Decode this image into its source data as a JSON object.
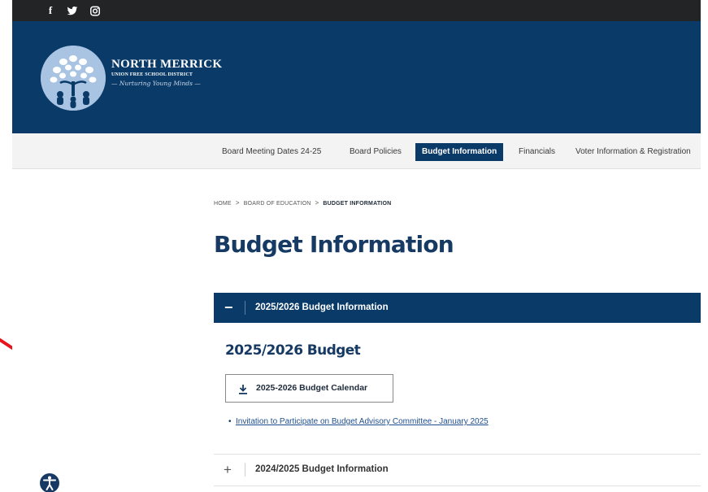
{
  "social": {
    "facebook_glyph": "f",
    "icons": [
      "facebook-icon",
      "twitter-icon",
      "instagram-icon"
    ]
  },
  "header": {
    "district_name": "NORTH MERRICK",
    "district_subtitle": "UNION FREE SCHOOL DISTRICT",
    "tagline": "— Nurturing Young Minds —",
    "logo_icon": "tree-logo-icon",
    "background_color": "#0a3a67"
  },
  "nav": {
    "items": [
      {
        "label": "Board Meeting Dates 24-25",
        "active": false
      },
      {
        "label": "Board Policies",
        "active": false
      },
      {
        "label": "Budget Information",
        "active": true
      },
      {
        "label": "Financials",
        "active": false
      },
      {
        "label": "Voter Information & Registration",
        "active": false
      }
    ]
  },
  "breadcrumb": {
    "items": [
      "HOME",
      "BOARD OF EDUCATION",
      "BUDGET INFORMATION"
    ],
    "separator": ">"
  },
  "page": {
    "title": "Budget Information"
  },
  "accordion": {
    "open": {
      "toggle": "−",
      "label": "2025/2026 Budget Information",
      "section_title": "2025/2026 Budget",
      "button_label": "2025-2026 Budget Calendar",
      "button_icon": "download-icon",
      "bullet": "•",
      "links": [
        "Invitation to Participate on Budget Advisory Committee - January 2025"
      ]
    },
    "closed": {
      "toggle": "+",
      "label": "2024/2025 Budget Information"
    }
  },
  "accessibility": {
    "icon": "accessibility-icon"
  },
  "annotation": {
    "icon": "red-arrow-icon",
    "color": "#e8141b"
  }
}
